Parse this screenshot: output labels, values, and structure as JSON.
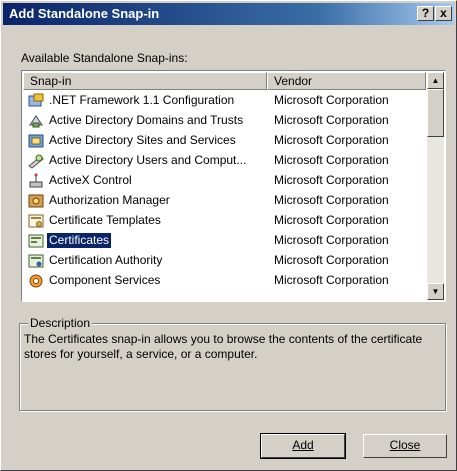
{
  "window": {
    "title": "Add Standalone Snap-in",
    "help_label": "?",
    "close_label": "x"
  },
  "available_label": "Available Standalone Snap-ins:",
  "list": {
    "columns": [
      "Snap-in",
      "Vendor"
    ],
    "items": [
      {
        "name": ".NET Framework 1.1 Configuration",
        "vendor": "Microsoft Corporation",
        "icon": "dotnet-icon"
      },
      {
        "name": "Active Directory Domains and Trusts",
        "vendor": "Microsoft Corporation",
        "icon": "ad-domains-icon"
      },
      {
        "name": "Active Directory Sites and Services",
        "vendor": "Microsoft Corporation",
        "icon": "ad-sites-icon"
      },
      {
        "name": "Active Directory Users and Comput...",
        "vendor": "Microsoft Corporation",
        "icon": "ad-users-icon"
      },
      {
        "name": "ActiveX Control",
        "vendor": "Microsoft Corporation",
        "icon": "activex-icon"
      },
      {
        "name": "Authorization Manager",
        "vendor": "Microsoft Corporation",
        "icon": "authorization-icon"
      },
      {
        "name": "Certificate Templates",
        "vendor": "Microsoft Corporation",
        "icon": "cert-templates-icon"
      },
      {
        "name": "Certificates",
        "vendor": "Microsoft Corporation",
        "icon": "certificates-icon",
        "selected": true
      },
      {
        "name": "Certification Authority",
        "vendor": "Microsoft Corporation",
        "icon": "cert-authority-icon"
      },
      {
        "name": "Component Services",
        "vendor": "Microsoft Corporation",
        "icon": "component-services-icon"
      }
    ],
    "scroll_up_glyph": "▲",
    "scroll_down_glyph": "▼"
  },
  "description": {
    "legend": "Description",
    "text": "The Certificates snap-in allows you to browse the contents of the certificate stores for yourself, a service, or a computer."
  },
  "buttons": {
    "add_label": "Add",
    "close_label": "Close"
  },
  "colors": {
    "title_bar": "#0a246a",
    "selection": "#0a246a",
    "dialog_face": "#d4d0c8"
  }
}
